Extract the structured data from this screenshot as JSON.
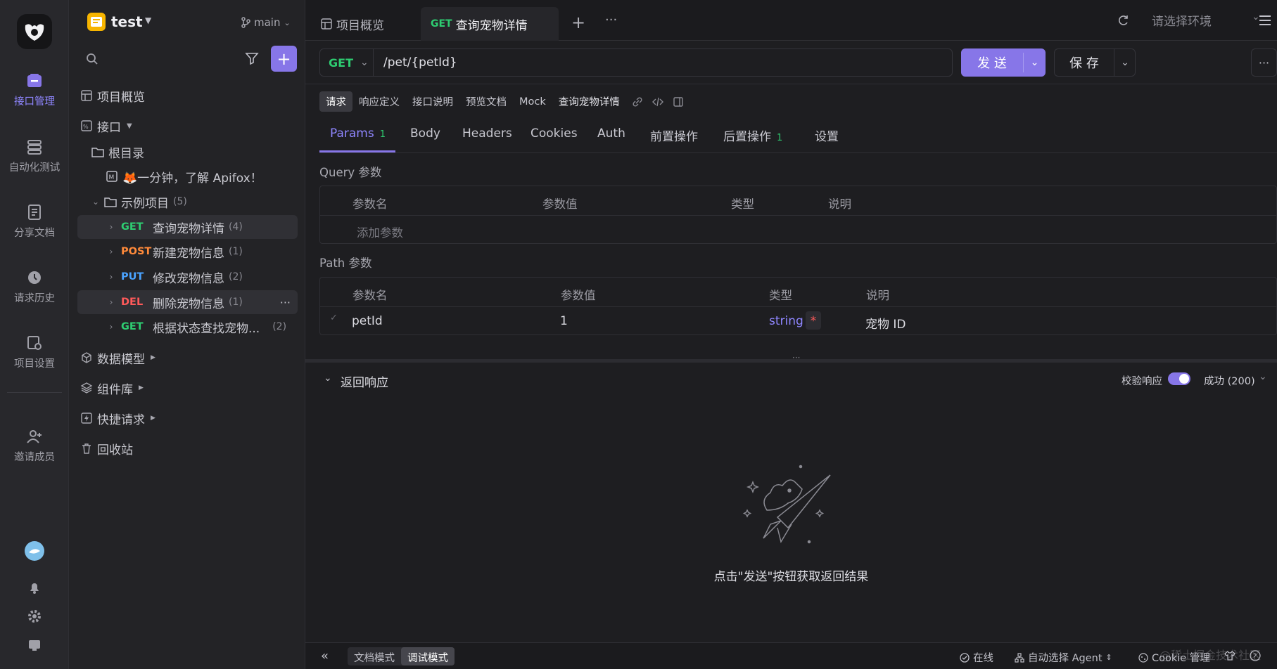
{
  "rail": {
    "items": [
      {
        "label": "接口管理"
      },
      {
        "label": "自动化测试"
      },
      {
        "label": "分享文档"
      },
      {
        "label": "请求历史"
      },
      {
        "label": "项目设置"
      },
      {
        "label": "邀请成员"
      }
    ]
  },
  "project": {
    "name": "test",
    "branch": "main"
  },
  "tree": {
    "overview": "项目概览",
    "api": "接口",
    "root": "根目录",
    "intro": "🦊一分钟，了解 Apifox！",
    "folder": "示例项目",
    "folder_count": "(5)",
    "endpoints": [
      {
        "method": "GET",
        "name": "查询宠物详情",
        "count": "(4)"
      },
      {
        "method": "POST",
        "name": "新建宠物信息",
        "count": "(1)"
      },
      {
        "method": "PUT",
        "name": "修改宠物信息",
        "count": "(2)"
      },
      {
        "method": "DEL",
        "name": "删除宠物信息",
        "count": "(1)"
      },
      {
        "method": "GET",
        "name": "根据状态查找宠物...",
        "count": "(2)"
      }
    ],
    "data_model": "数据模型",
    "components": "组件库",
    "quick_request": "快捷请求",
    "recycle": "回收站"
  },
  "tabs": {
    "overview": "项目概览",
    "active_method": "GET",
    "active_name": "查询宠物详情",
    "env_placeholder": "请选择环境"
  },
  "request": {
    "method": "GET",
    "url": "/pet/{petId}",
    "send": "发 送",
    "save": "保 存"
  },
  "subtabs": [
    "请求",
    "响应定义",
    "接口说明",
    "预览文档",
    "Mock"
  ],
  "endpoint_title": "查询宠物详情",
  "param_tabs": [
    {
      "label": "Params",
      "badge": "1"
    },
    {
      "label": "Body",
      "badge": ""
    },
    {
      "label": "Headers",
      "badge": ""
    },
    {
      "label": "Cookies",
      "badge": ""
    },
    {
      "label": "Auth",
      "badge": ""
    },
    {
      "label": "前置操作",
      "badge": ""
    },
    {
      "label": "后置操作",
      "badge": "1"
    },
    {
      "label": "设置",
      "badge": ""
    }
  ],
  "query": {
    "title": "Query 参数",
    "headers": [
      "参数名",
      "参数值",
      "类型",
      "说明"
    ],
    "add_placeholder": "添加参数"
  },
  "path": {
    "title": "Path 参数",
    "headers": [
      "参数名",
      "参数值",
      "类型",
      "说明"
    ],
    "row": {
      "name": "petId",
      "value": "1",
      "type": "string",
      "required": "*",
      "desc": "宠物 ID"
    }
  },
  "response": {
    "title": "返回响应",
    "validate": "校验响应",
    "status": "成功 (200)",
    "empty_hint": "点击\"发送\"按钮获取返回结果"
  },
  "bottombar": {
    "doc_mode": "文档模式",
    "debug_mode": "调试模式",
    "online": "在线",
    "agent": "自动选择 Agent",
    "cookie": "Cookie 管理",
    "watermark": "@稀土掘金技术社区"
  },
  "colors": {
    "accent": "#8776e8",
    "get": "#2ecc71",
    "post": "#ff8a3a",
    "put": "#4aa3ff",
    "del": "#ff5a5a"
  }
}
